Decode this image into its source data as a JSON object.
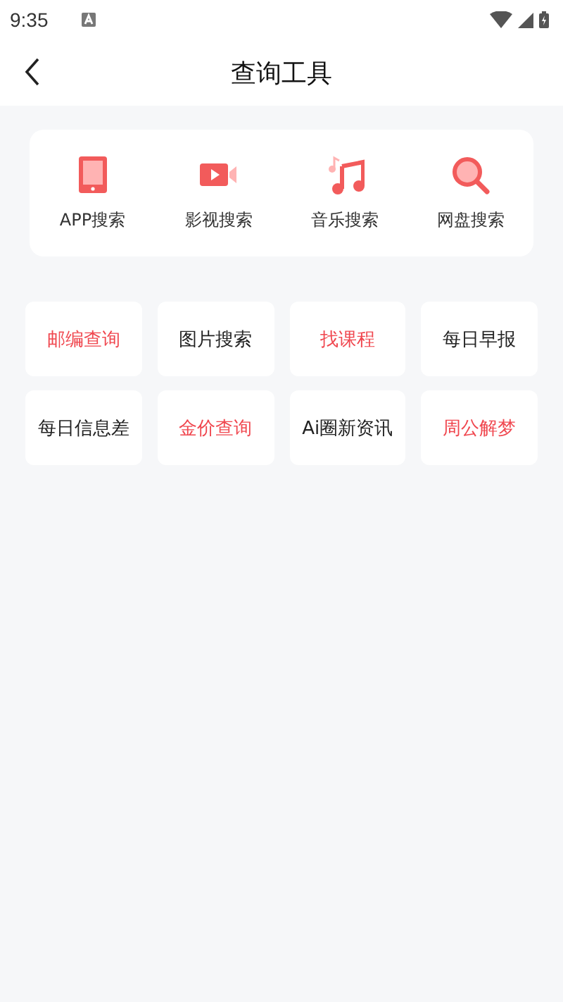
{
  "status_bar": {
    "time": "9:35"
  },
  "header": {
    "title": "查询工具"
  },
  "search_tools": [
    {
      "kind": "tablet",
      "label": "APP搜索"
    },
    {
      "kind": "video",
      "label": "影视搜索"
    },
    {
      "kind": "music",
      "label": "音乐搜索"
    },
    {
      "kind": "search",
      "label": "网盘搜索"
    }
  ],
  "tools": [
    {
      "label": "邮编查询",
      "color": "#f0474f"
    },
    {
      "label": "图片搜索",
      "color": "#222222"
    },
    {
      "label": "找课程",
      "color": "#f0474f"
    },
    {
      "label": "每日早报",
      "color": "#222222"
    },
    {
      "label": "每日信息差",
      "color": "#222222"
    },
    {
      "label": "金价查询",
      "color": "#f0474f"
    },
    {
      "label": "Ai圈新资讯",
      "color": "#222222"
    },
    {
      "label": "周公解梦",
      "color": "#f0474f"
    }
  ]
}
